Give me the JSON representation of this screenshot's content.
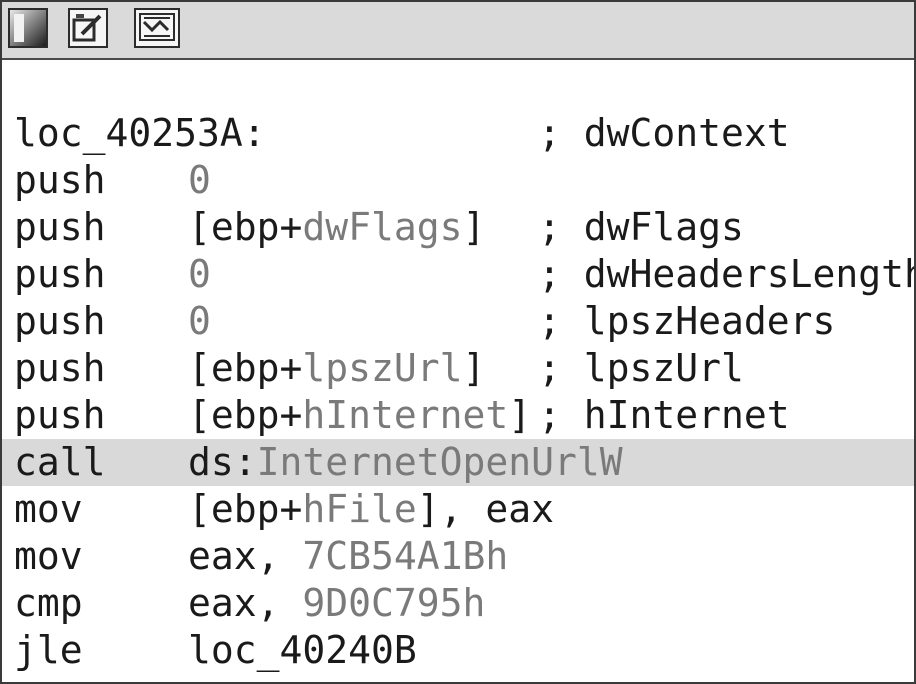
{
  "toolbar": {
    "buttons": [
      {
        "name": "graph-view-icon"
      },
      {
        "name": "edit-icon"
      },
      {
        "name": "navigate-icon"
      }
    ]
  },
  "code": {
    "label_line": {
      "label": "loc_40253A:",
      "comment": "; dwContext"
    },
    "instructions": [
      {
        "mnemonic": "push",
        "op_pre": "",
        "op_sym": "",
        "op_post": "",
        "op_const": "0",
        "comment": ""
      },
      {
        "mnemonic": "push",
        "op_pre": "[ebp+",
        "op_sym": "dwFlags",
        "op_post": "]",
        "op_const": "",
        "comment": "; dwFlags"
      },
      {
        "mnemonic": "push",
        "op_pre": "",
        "op_sym": "",
        "op_post": "",
        "op_const": "0",
        "comment": "; dwHeadersLength"
      },
      {
        "mnemonic": "push",
        "op_pre": "",
        "op_sym": "",
        "op_post": "",
        "op_const": "0",
        "comment": "; lpszHeaders"
      },
      {
        "mnemonic": "push",
        "op_pre": "[ebp+",
        "op_sym": "lpszUrl",
        "op_post": "]",
        "op_const": "",
        "comment": "; lpszUrl"
      },
      {
        "mnemonic": "push",
        "op_pre": "[ebp+",
        "op_sym": "hInternet",
        "op_post": "]",
        "op_const": "",
        "comment": "; hInternet"
      },
      {
        "mnemonic": "call",
        "op_pre": "ds:",
        "op_sym": "InternetOpenUrlW",
        "op_post": "",
        "op_const": "",
        "comment": ""
      },
      {
        "mnemonic": "mov",
        "op_pre": "[ebp+",
        "op_sym": "hFile",
        "op_post": "], eax",
        "op_const": "",
        "comment": ""
      },
      {
        "mnemonic": "mov",
        "op_pre": "eax, ",
        "op_sym": "",
        "op_post": "",
        "op_const": "7CB54A1Bh",
        "comment": ""
      },
      {
        "mnemonic": "cmp",
        "op_pre": "eax, ",
        "op_sym": "",
        "op_post": "",
        "op_const": "9D0C795h",
        "comment": ""
      },
      {
        "mnemonic": "jle",
        "op_pre": "loc_40240B",
        "op_sym": "",
        "op_post": "",
        "op_const": "",
        "comment": ""
      }
    ],
    "highlighted_index": 6
  }
}
